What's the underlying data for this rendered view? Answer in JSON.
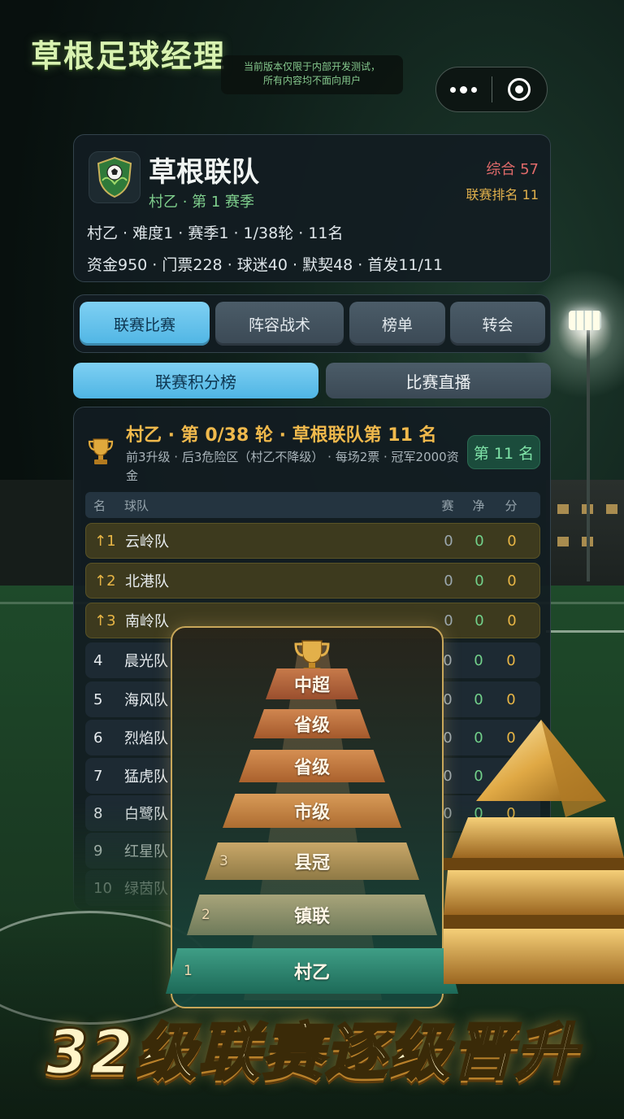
{
  "app": {
    "title": "草根足球经理",
    "notice_line1": "当前版本仅限于内部开发测试，",
    "notice_line2": "所有内容均不面向用户"
  },
  "capsule": {
    "more_icon": "more-dots-icon",
    "close_icon": "target-close-icon"
  },
  "team": {
    "name": "草根联队",
    "subtitle": "村乙 · 第 1 赛季",
    "overall": "综合 57",
    "league_rank": "联赛排名 11",
    "info_line1": "村乙 · 难度1 · 赛季1 · 1/38轮 · 11名",
    "info_line2": "资金950 · 门票228 · 球迷40 · 默契48 · 首发11/11",
    "crest_icon": "shield-ball-icon"
  },
  "tabs": [
    {
      "label": "联赛比赛",
      "active": true
    },
    {
      "label": "阵容战术",
      "active": false
    },
    {
      "label": "榜单",
      "active": false
    },
    {
      "label": "转会",
      "active": false
    }
  ],
  "subtabs": [
    {
      "label": "联赛积分榜",
      "active": true
    },
    {
      "label": "比赛直播",
      "active": false
    }
  ],
  "standings": {
    "title": "村乙 · 第 0/38 轮 · 草根联队第 11 名",
    "description": "前3升级 · 后3危险区（村乙不降级） · 每场2票 · 冠军2000资金",
    "rank_badge": "第 11 名",
    "headers": {
      "rank": "名",
      "team": "球队",
      "played": "赛",
      "gd": "净",
      "pts": "分"
    },
    "rows": [
      {
        "rank": "↑1",
        "team": "云岭队",
        "played": "0",
        "gd": "0",
        "pts": "0",
        "zone": "promo"
      },
      {
        "rank": "↑2",
        "team": "北港队",
        "played": "0",
        "gd": "0",
        "pts": "0",
        "zone": "promo"
      },
      {
        "rank": "↑3",
        "team": "南岭队",
        "played": "0",
        "gd": "0",
        "pts": "0",
        "zone": "promo"
      },
      {
        "rank": "4",
        "team": "晨光队",
        "played": "0",
        "gd": "0",
        "pts": "0",
        "zone": "normal"
      },
      {
        "rank": "5",
        "team": "海风队",
        "played": "0",
        "gd": "0",
        "pts": "0",
        "zone": "normal"
      },
      {
        "rank": "6",
        "team": "烈焰队",
        "played": "0",
        "gd": "0",
        "pts": "0",
        "zone": "normal"
      },
      {
        "rank": "7",
        "team": "猛虎队",
        "played": "0",
        "gd": "0",
        "pts": "0",
        "zone": "normal"
      },
      {
        "rank": "8",
        "team": "白鹭队",
        "played": "0",
        "gd": "0",
        "pts": "0",
        "zone": "normal"
      },
      {
        "rank": "9",
        "team": "红星队",
        "played": "",
        "gd": "",
        "pts": "",
        "zone": "normal"
      },
      {
        "rank": "10",
        "team": "绿茵队",
        "played": "",
        "gd": "",
        "pts": "",
        "zone": "normal"
      }
    ]
  },
  "pyramid": {
    "tiers": [
      {
        "label": "中超",
        "num": ""
      },
      {
        "label": "省级",
        "num": ""
      },
      {
        "label": "省级",
        "num": ""
      },
      {
        "label": "市级",
        "num": ""
      },
      {
        "label": "县冠",
        "num": "3"
      },
      {
        "label": "镇联",
        "num": "2"
      },
      {
        "label": "村乙",
        "num": "1"
      }
    ]
  },
  "banner": {
    "text": "32级联赛逐级晋升"
  },
  "colors": {
    "accent": "#4fb5e4",
    "gold": "#e7b545",
    "green": "#72d08a",
    "panel": "#121c22"
  }
}
